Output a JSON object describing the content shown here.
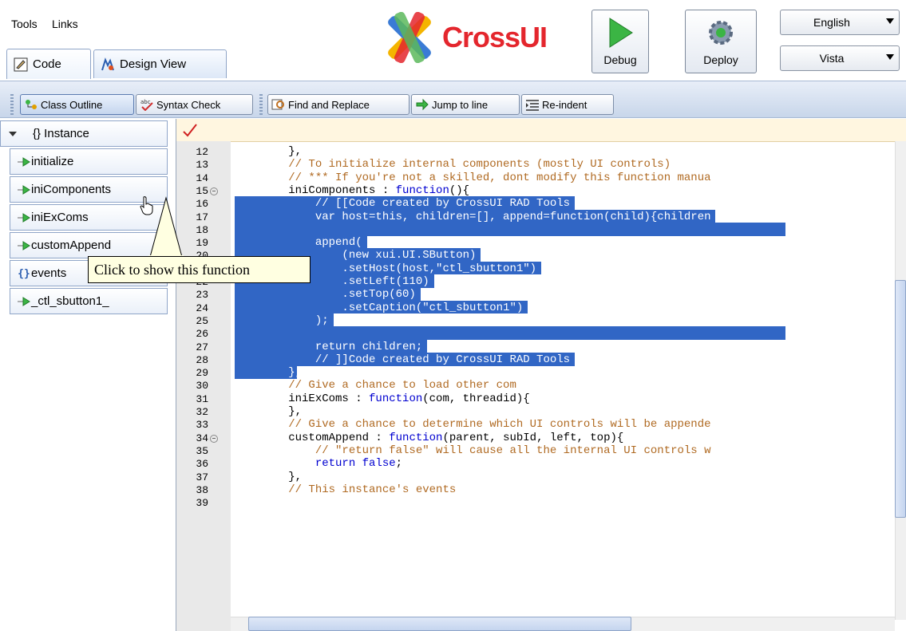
{
  "menu": {
    "tools": "Tools",
    "links": "Links"
  },
  "tabs": [
    {
      "label": "Code"
    },
    {
      "label": "Design View"
    }
  ],
  "logo": {
    "text": "CrossUI"
  },
  "actions": {
    "debug": "Debug",
    "deploy": "Deploy"
  },
  "language": {
    "selected": "English"
  },
  "theme": {
    "selected": "Vista"
  },
  "toolbar": {
    "class_outline": "Class Outline",
    "syntax_check": "Syntax Check",
    "find_replace": "Find and Replace",
    "jump_line": "Jump to line",
    "reindent": "Re-indent"
  },
  "outline": {
    "root": "{} Instance",
    "items": [
      {
        "label": "initialize",
        "kind": "method"
      },
      {
        "label": "iniComponents",
        "kind": "method"
      },
      {
        "label": "iniExComs",
        "kind": "method"
      },
      {
        "label": "customAppend",
        "kind": "method"
      },
      {
        "label": "events",
        "kind": "object"
      },
      {
        "label": "_ctl_sbutton1_",
        "kind": "method"
      }
    ]
  },
  "tooltip": {
    "text": "Click to show this function"
  },
  "colors": {
    "accent": "#3166c5",
    "comment": "#b06a22",
    "keyword": "#0000d0",
    "tooltip_bg": "#ffffe1"
  },
  "editor": {
    "lines": [
      {
        "n": "12",
        "text": "        },"
      },
      {
        "n": "13",
        "text": "        // To initialize internal components (mostly UI controls)"
      },
      {
        "n": "14",
        "text": "        // *** If you're not a skilled, dont modify this function manua"
      },
      {
        "n": "15",
        "text": "        iniComponents : function(){"
      },
      {
        "n": "16",
        "text": "            // [[Code created by CrossUI RAD Tools"
      },
      {
        "n": "17",
        "text": "            var host=this, children=[], append=function(child){children"
      },
      {
        "n": "18",
        "text": ""
      },
      {
        "n": "19",
        "text": "            append("
      },
      {
        "n": "20",
        "text": "                (new xui.UI.SButton)"
      },
      {
        "n": "21",
        "text": "                .setHost(host,\"ctl_sbutton1\")"
      },
      {
        "n": "22",
        "text": "                .setLeft(110)"
      },
      {
        "n": "23",
        "text": "                .setTop(60)"
      },
      {
        "n": "24",
        "text": "                .setCaption(\"ctl_sbutton1\")"
      },
      {
        "n": "25",
        "text": "            );"
      },
      {
        "n": "26",
        "text": ""
      },
      {
        "n": "27",
        "text": "            return children;"
      },
      {
        "n": "28",
        "text": "            // ]]Code created by CrossUI RAD Tools"
      },
      {
        "n": "29",
        "text": "        },"
      },
      {
        "n": "30",
        "text": "        // Give a chance to load other com"
      },
      {
        "n": "31",
        "text": "        iniExComs : function(com, threadid){"
      },
      {
        "n": "32",
        "text": "        },"
      },
      {
        "n": "33",
        "text": "        // Give a chance to determine which UI controls will be appende"
      },
      {
        "n": "34",
        "text": "        customAppend : function(parent, subId, left, top){"
      },
      {
        "n": "35",
        "text": "            // \"return false\" will cause all the internal UI controls w"
      },
      {
        "n": "36",
        "text": "            return false;"
      },
      {
        "n": "37",
        "text": "        },"
      },
      {
        "n": "38",
        "text": "        // This instance's events"
      },
      {
        "n": "39",
        "text": ""
      }
    ]
  }
}
